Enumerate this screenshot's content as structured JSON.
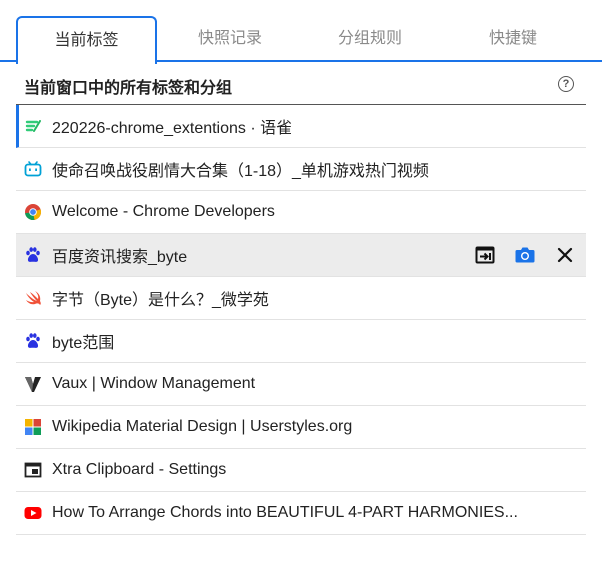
{
  "tabs": [
    {
      "label": "当前标签",
      "active": true
    },
    {
      "label": "快照记录",
      "active": false
    },
    {
      "label": "分组规则",
      "active": false
    },
    {
      "label": "快捷键",
      "active": false
    }
  ],
  "section": {
    "title": "当前窗口中的所有标签和分组",
    "help": "?"
  },
  "rows": [
    {
      "title": "220226-chrome_extentions · 语雀",
      "icon": "yuque-icon"
    },
    {
      "title": "使命召唤战役剧情大合集（1-18）_单机游戏热门视频",
      "icon": "bilibili-icon"
    },
    {
      "title": "Welcome - Chrome Developers",
      "icon": "chrome-icon"
    },
    {
      "title": "百度资讯搜索_byte",
      "icon": "baidu-icon"
    },
    {
      "title": "字节（Byte）是什么？_微学苑",
      "icon": "swift-icon"
    },
    {
      "title": "byte范围",
      "icon": "baidu-icon"
    },
    {
      "title": "Vaux | Window Management",
      "icon": "vaux-icon"
    },
    {
      "title": "Wikipedia Material Design | Userstyles.org",
      "icon": "userstyles-icon"
    },
    {
      "title": "Xtra Clipboard - Settings",
      "icon": "window-icon"
    },
    {
      "title": "How To Arrange Chords into BEAUTIFUL 4-PART HARMONIES...",
      "icon": "youtube-icon"
    }
  ],
  "colors": {
    "accent": "#1a73e8",
    "youtube": "#ff0000",
    "baidu": "#2932e1"
  }
}
